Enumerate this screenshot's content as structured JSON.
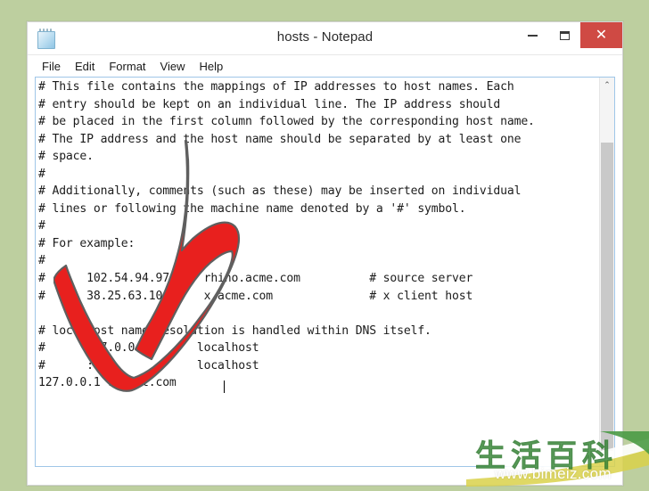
{
  "desktop": {
    "background_color": "#bdcf9f"
  },
  "window": {
    "title": "hosts - Notepad",
    "app_icon_name": "notepad-icon",
    "controls": {
      "minimize_label": "—",
      "maximize_label": "",
      "close_label": "✕",
      "close_color": "#cf4a44"
    }
  },
  "menubar": {
    "items": [
      {
        "label": "File"
      },
      {
        "label": "Edit"
      },
      {
        "label": "Format"
      },
      {
        "label": "View"
      },
      {
        "label": "Help"
      }
    ]
  },
  "editor": {
    "content": "# This file contains the mappings of IP addresses to host names. Each\n# entry should be kept on an individual line. The IP address should\n# be placed in the first column followed by the corresponding host name.\n# The IP address and the host name should be separated by at least one\n# space.\n#\n# Additionally, comments (such as these) may be inserted on individual\n# lines or following the machine name denoted by a '#' symbol.\n#\n# For example:\n#\n#      102.54.94.97     rhino.acme.com          # source server\n#      38.25.63.10      x.acme.com              # x client host\n\n# localhost name resolution is handled within DNS itself.\n#      127.0.0.1       localhost\n#      ::1             localhost\n127.0.0.1 reddit.com",
    "caret_line": "127.0.0.1 reddit.com",
    "scrollbar": {
      "up_arrow": "⌃",
      "down_arrow": "⌄",
      "thumb_color": "#c9c9c9"
    }
  },
  "annotation": {
    "arrow_name": "red-down-arrow",
    "arrow_color": "#e8201e",
    "arrow_outline": "#5a5a5a"
  },
  "watermark": {
    "chinese_text": "生活百科",
    "url": "www.bimeiz.com",
    "color": "#3f8f3f"
  }
}
